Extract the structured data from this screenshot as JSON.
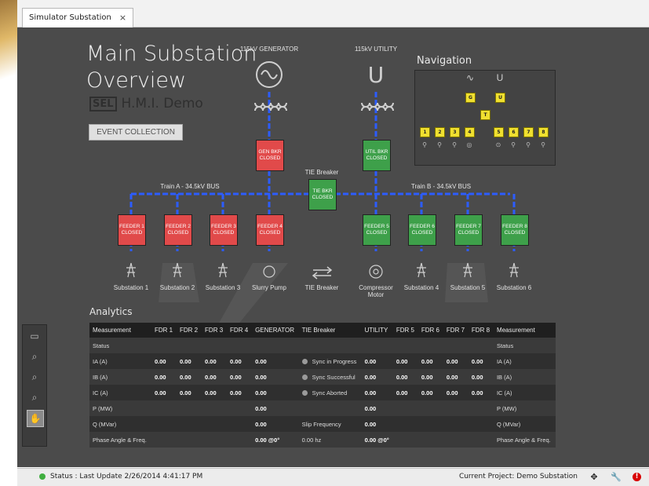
{
  "tab": {
    "label": "Simulator Substation",
    "close": "×"
  },
  "header": {
    "title_line1": "Main Substation",
    "title_line2": "Overview",
    "logo_sel": "SEL",
    "logo_text": "H.M.I. Demo"
  },
  "event_button": "EVENT COLLECTION",
  "sources": {
    "gen": "115kV GENERATOR",
    "util": "115kV UTILITY"
  },
  "breakers": {
    "gen": {
      "l1": "GEN BKR",
      "l2": "CLOSED"
    },
    "util": {
      "l1": "UTIL BKR",
      "l2": "CLOSED"
    },
    "tie": {
      "l1": "TIE BKR",
      "l2": "CLOSED"
    },
    "feeders": [
      {
        "l1": "FEEDER 1",
        "l2": "CLOSED",
        "state": "red",
        "load": "Substation 1"
      },
      {
        "l1": "FEEDER 2",
        "l2": "CLOSED",
        "state": "red",
        "load": "Substation 2"
      },
      {
        "l1": "FEEDER 3",
        "l2": "CLOSED",
        "state": "red",
        "load": "Substation 3"
      },
      {
        "l1": "FEEDER 4",
        "l2": "CLOSED",
        "state": "red",
        "load": "Slurry Pump"
      },
      {
        "l1": "FEEDER 5",
        "l2": "CLOSED",
        "state": "green",
        "load": "Compressor\nMotor"
      },
      {
        "l1": "FEEDER 6",
        "l2": "CLOSED",
        "state": "green",
        "load": "Substation 4"
      },
      {
        "l1": "FEEDER 7",
        "l2": "CLOSED",
        "state": "green",
        "load": "Substation 5"
      },
      {
        "l1": "FEEDER 8",
        "l2": "CLOSED",
        "state": "green",
        "load": "Substation 6"
      }
    ]
  },
  "buses": {
    "a": "Train A - 34.5kV BUS",
    "b": "Train B - 34.5kV BUS",
    "tie_label": "TIE Breaker",
    "tie_bottom": "TIE Breaker"
  },
  "navigation": {
    "title": "Navigation",
    "g": "G",
    "u": "U",
    "t": "T",
    "feeders": [
      "1",
      "2",
      "3",
      "4",
      "5",
      "6",
      "7",
      "8"
    ]
  },
  "analytics": {
    "title": "Analytics",
    "headers": [
      "Measurement",
      "FDR 1",
      "FDR 2",
      "FDR 3",
      "FDR 4",
      "GENERATOR",
      "TIE Breaker",
      "UTILITY",
      "FDR 5",
      "FDR 6",
      "FDR 7",
      "FDR 8",
      "Measurement"
    ],
    "rows": [
      {
        "m": "Status",
        "vals": [
          "",
          "",
          "",
          "",
          "",
          "",
          "",
          "",
          "",
          "",
          "",
          ""
        ],
        "mr": "Status"
      },
      {
        "m": "IA (A)",
        "vals": [
          "0.00",
          "0.00",
          "0.00",
          "0.00",
          "0.00",
          "Sync in Progress",
          "0.00",
          "0.00",
          "0.00",
          "0.00",
          "0.00"
        ],
        "mr": "IA (A)",
        "dot": true
      },
      {
        "m": "IB (A)",
        "vals": [
          "0.00",
          "0.00",
          "0.00",
          "0.00",
          "0.00",
          "Sync Successful",
          "0.00",
          "0.00",
          "0.00",
          "0.00",
          "0.00"
        ],
        "mr": "IB (A)",
        "dot": true
      },
      {
        "m": "IC (A)",
        "vals": [
          "0.00",
          "0.00",
          "0.00",
          "0.00",
          "0.00",
          "Sync Aborted",
          "0.00",
          "0.00",
          "0.00",
          "0.00",
          "0.00"
        ],
        "mr": "IC (A)",
        "dot": true
      },
      {
        "m": "P (MW)",
        "vals": [
          "",
          "",
          "",
          "",
          "0.00",
          "",
          "0.00",
          "",
          "",
          "",
          ""
        ],
        "mr": "P (MW)"
      },
      {
        "m": "Q (MVar)",
        "vals": [
          "",
          "",
          "",
          "",
          "0.00",
          "Slip Frequency",
          "0.00",
          "",
          "",
          "",
          ""
        ],
        "mr": "Q (MVar)"
      },
      {
        "m": "Phase Angle & Freq.",
        "vals": [
          "",
          "",
          "",
          "",
          "0.00 @0°",
          "0.00 hz",
          "0.00 @0°",
          "",
          "",
          "",
          ""
        ],
        "mr": "Phase Angle & Freq."
      }
    ]
  },
  "status": {
    "text": "Status : Last Update 2/26/2014 4:41:17 PM",
    "project": "Current Project: Demo Substation"
  },
  "colors": {
    "bus": "#2c5cff",
    "closed_red": "#e14a4a",
    "closed_green": "#3ea04a",
    "nav_yellow": "#f0e030"
  }
}
